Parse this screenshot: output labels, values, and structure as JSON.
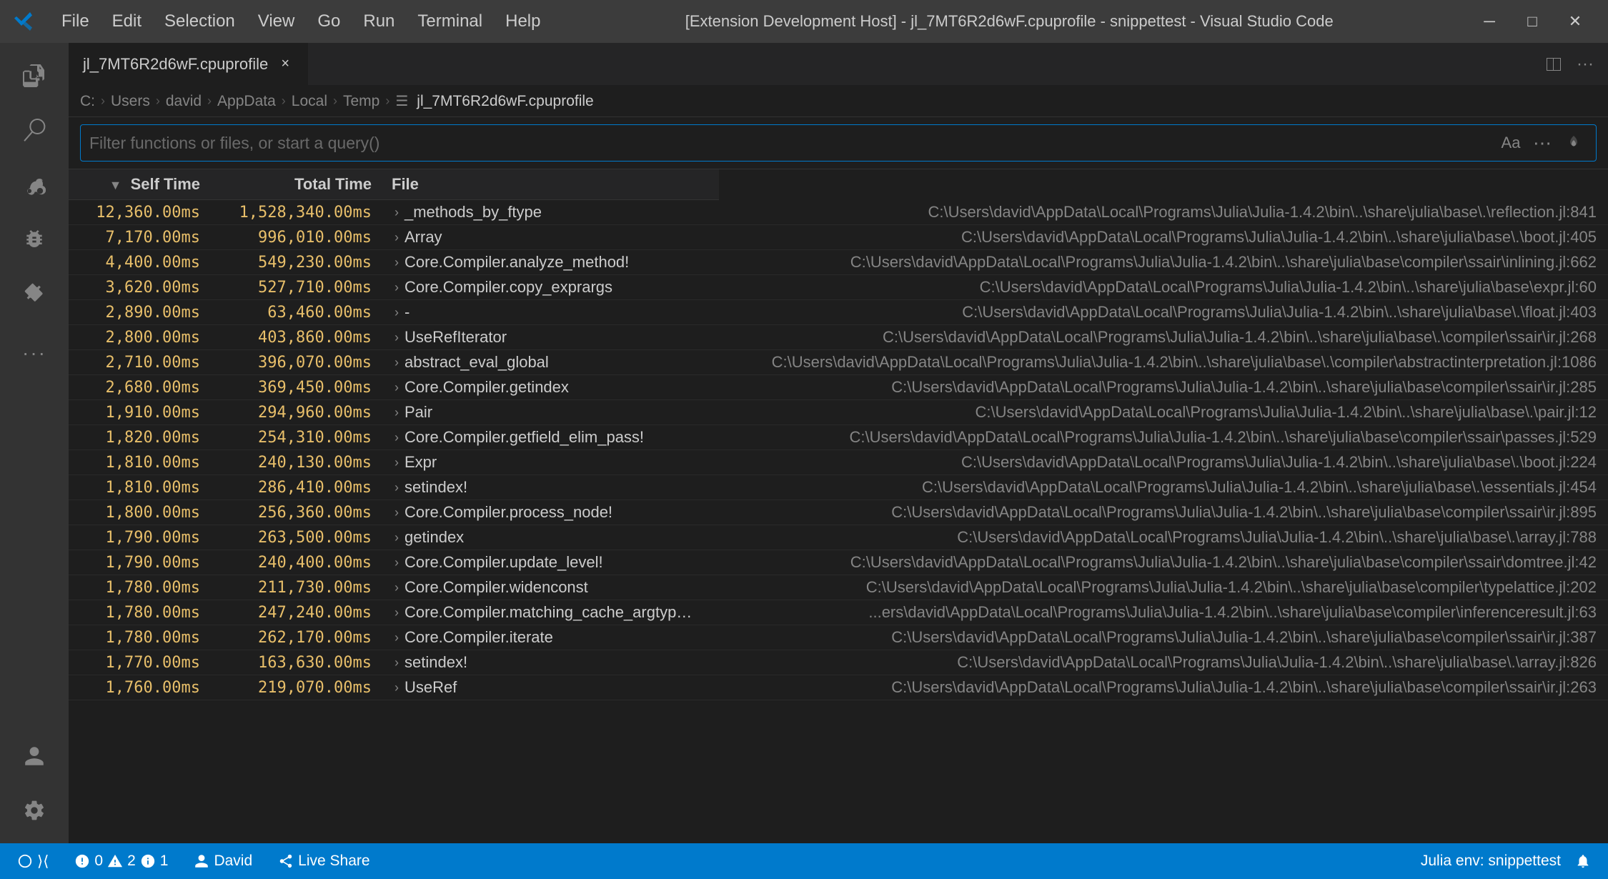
{
  "titlebar": {
    "menu_items": [
      "File",
      "Edit",
      "Selection",
      "View",
      "Go",
      "Run",
      "Terminal",
      "Help"
    ],
    "title": "[Extension Development Host] - jl_7MT6R2d6wF.cpuprofile - snippettest - Visual Studio Code",
    "minimize": "─",
    "maximize": "□",
    "close": "✕"
  },
  "tab": {
    "name": "jl_7MT6R2d6wF.cpuprofile",
    "close_icon": "×"
  },
  "breadcrumb": {
    "items": [
      "C:",
      "Users",
      "david",
      "AppData",
      "Local",
      "Temp",
      "jl_7MT6R2d6wF.cpuprofile"
    ]
  },
  "filter": {
    "placeholder": "Filter functions or files, or start a query()"
  },
  "table": {
    "headers": {
      "self_time": "Self Time",
      "total_time": "Total Time",
      "file": "File"
    },
    "rows": [
      {
        "self_time": "12,360.00ms",
        "total_time": "1,528,340.00ms",
        "func": "_methods_by_ftype",
        "file": "C:\\Users\\david\\AppData\\Local\\Programs\\Julia\\Julia-1.4.2\\bin\\..\\share\\julia\\base\\.\\reflection.jl:841"
      },
      {
        "self_time": "7,170.00ms",
        "total_time": "996,010.00ms",
        "func": "Array",
        "file": "C:\\Users\\david\\AppData\\Local\\Programs\\Julia\\Julia-1.4.2\\bin\\..\\share\\julia\\base\\.\\boot.jl:405"
      },
      {
        "self_time": "4,400.00ms",
        "total_time": "549,230.00ms",
        "func": "Core.Compiler.analyze_method!",
        "file": "C:\\Users\\david\\AppData\\Local\\Programs\\Julia\\Julia-1.4.2\\bin\\..\\share\\julia\\base\\compiler\\ssair\\inlining.jl:662"
      },
      {
        "self_time": "3,620.00ms",
        "total_time": "527,710.00ms",
        "func": "Core.Compiler.copy_exprargs",
        "file": "C:\\Users\\david\\AppData\\Local\\Programs\\Julia\\Julia-1.4.2\\bin\\..\\share\\julia\\base\\expr.jl:60"
      },
      {
        "self_time": "2,890.00ms",
        "total_time": "63,460.00ms",
        "func": "-",
        "file": "C:\\Users\\david\\AppData\\Local\\Programs\\Julia\\Julia-1.4.2\\bin\\..\\share\\julia\\base\\.\\float.jl:403"
      },
      {
        "self_time": "2,800.00ms",
        "total_time": "403,860.00ms",
        "func": "UseRefIterator",
        "file": "C:\\Users\\david\\AppData\\Local\\Programs\\Julia\\Julia-1.4.2\\bin\\..\\share\\julia\\base\\.\\compiler\\ssair\\ir.jl:268"
      },
      {
        "self_time": "2,710.00ms",
        "total_time": "396,070.00ms",
        "func": "abstract_eval_global",
        "file": "C:\\Users\\david\\AppData\\Local\\Programs\\Julia\\Julia-1.4.2\\bin\\..\\share\\julia\\base\\.\\compiler\\abstractinterpretation.jl:1086"
      },
      {
        "self_time": "2,680.00ms",
        "total_time": "369,450.00ms",
        "func": "Core.Compiler.getindex",
        "file": "C:\\Users\\david\\AppData\\Local\\Programs\\Julia\\Julia-1.4.2\\bin\\..\\share\\julia\\base\\compiler\\ssair\\ir.jl:285"
      },
      {
        "self_time": "1,910.00ms",
        "total_time": "294,960.00ms",
        "func": "Pair",
        "file": "C:\\Users\\david\\AppData\\Local\\Programs\\Julia\\Julia-1.4.2\\bin\\..\\share\\julia\\base\\.\\pair.jl:12"
      },
      {
        "self_time": "1,820.00ms",
        "total_time": "254,310.00ms",
        "func": "Core.Compiler.getfield_elim_pass!",
        "file": "C:\\Users\\david\\AppData\\Local\\Programs\\Julia\\Julia-1.4.2\\bin\\..\\share\\julia\\base\\compiler\\ssair\\passes.jl:529"
      },
      {
        "self_time": "1,810.00ms",
        "total_time": "240,130.00ms",
        "func": "Expr",
        "file": "C:\\Users\\david\\AppData\\Local\\Programs\\Julia\\Julia-1.4.2\\bin\\..\\share\\julia\\base\\.\\boot.jl:224"
      },
      {
        "self_time": "1,810.00ms",
        "total_time": "286,410.00ms",
        "func": "setindex!",
        "file": "C:\\Users\\david\\AppData\\Local\\Programs\\Julia\\Julia-1.4.2\\bin\\..\\share\\julia\\base\\.\\essentials.jl:454"
      },
      {
        "self_time": "1,800.00ms",
        "total_time": "256,360.00ms",
        "func": "Core.Compiler.process_node!",
        "file": "C:\\Users\\david\\AppData\\Local\\Programs\\Julia\\Julia-1.4.2\\bin\\..\\share\\julia\\base\\compiler\\ssair\\ir.jl:895"
      },
      {
        "self_time": "1,790.00ms",
        "total_time": "263,500.00ms",
        "func": "getindex",
        "file": "C:\\Users\\david\\AppData\\Local\\Programs\\Julia\\Julia-1.4.2\\bin\\..\\share\\julia\\base\\.\\array.jl:788"
      },
      {
        "self_time": "1,790.00ms",
        "total_time": "240,400.00ms",
        "func": "Core.Compiler.update_level!",
        "file": "C:\\Users\\david\\AppData\\Local\\Programs\\Julia\\Julia-1.4.2\\bin\\..\\share\\julia\\base\\compiler\\ssair\\domtree.jl:42"
      },
      {
        "self_time": "1,780.00ms",
        "total_time": "211,730.00ms",
        "func": "Core.Compiler.widenconst",
        "file": "C:\\Users\\david\\AppData\\Local\\Programs\\Julia\\Julia-1.4.2\\bin\\..\\share\\julia\\base\\compiler\\typelattice.jl:202"
      },
      {
        "self_time": "1,780.00ms",
        "total_time": "247,240.00ms",
        "func": "Core.Compiler.matching_cache_argtyp…",
        "file": "...ers\\david\\AppData\\Local\\Programs\\Julia\\Julia-1.4.2\\bin\\..\\share\\julia\\base\\compiler\\inferenceresult.jl:63"
      },
      {
        "self_time": "1,780.00ms",
        "total_time": "262,170.00ms",
        "func": "Core.Compiler.iterate",
        "file": "C:\\Users\\david\\AppData\\Local\\Programs\\Julia\\Julia-1.4.2\\bin\\..\\share\\julia\\base\\compiler\\ssair\\ir.jl:387"
      },
      {
        "self_time": "1,770.00ms",
        "total_time": "163,630.00ms",
        "func": "setindex!",
        "file": "C:\\Users\\david\\AppData\\Local\\Programs\\Julia\\Julia-1.4.2\\bin\\..\\share\\julia\\base\\.\\array.jl:826"
      },
      {
        "self_time": "1,760.00ms",
        "total_time": "219,070.00ms",
        "func": "UseRef",
        "file": "C:\\Users\\david\\AppData\\Local\\Programs\\Julia\\Julia-1.4.2\\bin\\..\\share\\julia\\base\\compiler\\ssair\\ir.jl:263"
      }
    ]
  },
  "activity_bar": {
    "items": [
      {
        "icon": "files",
        "label": "Explorer"
      },
      {
        "icon": "search",
        "label": "Search"
      },
      {
        "icon": "source-control",
        "label": "Source Control"
      },
      {
        "icon": "debug",
        "label": "Run and Debug"
      },
      {
        "icon": "extensions",
        "label": "Extensions"
      },
      {
        "icon": "more",
        "label": "More"
      }
    ]
  },
  "status_bar": {
    "error_count": "0",
    "warning_count": "2",
    "info_count": "1",
    "user": "David",
    "live_share": "Live Share",
    "julia_env": "Julia env: snippettest",
    "notifications_icon": "🔔",
    "settings_icon": "⚙"
  }
}
